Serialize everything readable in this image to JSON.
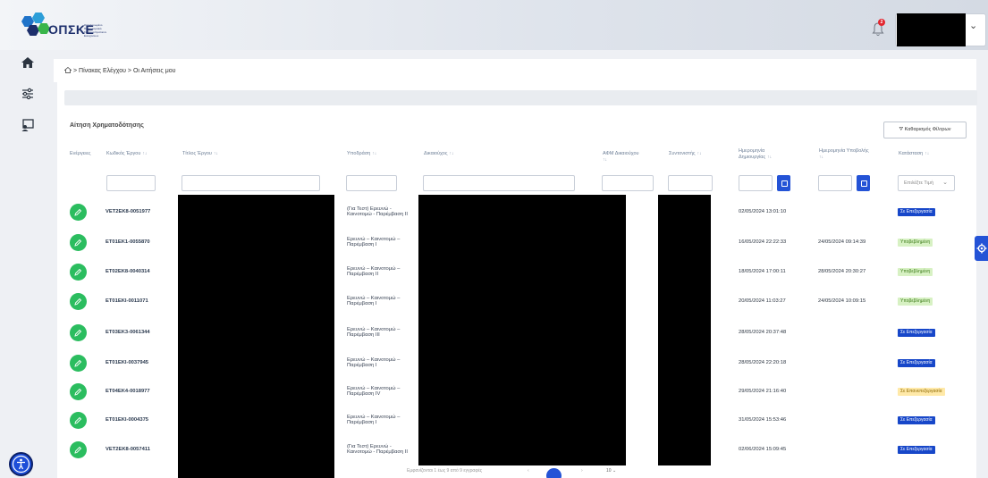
{
  "header": {
    "logo_text": "ΟΠΣΚΕ",
    "logo_subtitle": "Ολοκληρωμένο Πληροφοριακό Σύστημα Κρατικών Ενισχύσεων",
    "notification_count": "2"
  },
  "breadcrumb": "> Πίνακας Ελέγχου > Οι Αιτήσεις μου",
  "card": {
    "title": "Αίτηση Χρηματοδότησης",
    "clear_filters": "Καθαρισμός Φίλτρων"
  },
  "columns": {
    "actions": "Ενέργειες",
    "code": "Κωδικός Έργου",
    "title": "Τίτλος Έργου",
    "action_type": "Υποδράση",
    "beneficiary": "Δικαιούχος",
    "afm": "ΑΦΜ Δικαιούχου",
    "coordinator": "Συντονιστής",
    "created_1": "Ημερομηνία",
    "created_2": "Δημιουργίας",
    "submitted": "Ημερομηνία Υποβολής",
    "status": "Κατάσταση",
    "sort_glyph": "↑↓"
  },
  "filters": {
    "status_placeholder": "Επιλέξτε Τιμή"
  },
  "rows": [
    {
      "code": "VET2EK8-0051977",
      "action_1": "(Για Τεστ) Ερευνώ -",
      "action_2": "Καινοτομώ - Παρέμβαση ΙΙ",
      "created": "02/05/2024 13:01:10",
      "submitted": "",
      "status": "Σε Επεξεργασία"
    },
    {
      "code": "ET01EK1-0055870",
      "action_1": "Ερευνώ – Καινοτομώ –",
      "action_2": "Παρέμβαση Ι",
      "created": "16/05/2024 22:22:33",
      "submitted": "24/05/2024 09:14:39",
      "status": "Υποβεβλημένη"
    },
    {
      "code": "ET02EK8-0040314",
      "action_1": "Ερευνώ – Καινοτομώ –",
      "action_2": "Παρέμβαση ΙΙ",
      "created": "18/05/2024 17:00:11",
      "submitted": "28/05/2024 20:30:27",
      "status": "Υποβεβλημένη"
    },
    {
      "code": "ET01EKI-0011071",
      "action_1": "Ερευνώ – Καινοτομώ –",
      "action_2": "Παρέμβαση Ι",
      "created": "20/05/2024 11:03:27",
      "submitted": "24/05/2024 10:09:15",
      "status": "Υποβεβλημένη"
    },
    {
      "code": "ET03EK3-0061344",
      "action_1": "Ερευνώ – Καινοτομώ –",
      "action_2": "Παρέμβαση ΙΙΙ",
      "created": "28/05/2024 20:37:48",
      "submitted": "",
      "status": "Σε Επεξεργασία"
    },
    {
      "code": "ET01EKI-0037945",
      "action_1": "Ερευνώ – Καινοτομώ –",
      "action_2": "Παρέμβαση Ι",
      "created": "28/05/2024 22:20:18",
      "submitted": "",
      "status": "Σε Επεξεργασία"
    },
    {
      "code": "ET04EK4-0018977",
      "action_1": "Ερευνώ – Καινοτομώ –",
      "action_2": "Παρέμβαση IV",
      "created": "29/05/2024 21:16:40",
      "submitted": "",
      "status": "Σε Επανεπεξεργασία"
    },
    {
      "code": "ET01EKI-0004375",
      "action_1": "Ερευνώ – Καινοτομώ –",
      "action_2": "Παρέμβαση Ι",
      "created": "31/05/2024 15:53:46",
      "submitted": "",
      "status": "Σε Επεξεργασία"
    },
    {
      "code": "VET2EK8-0057411",
      "action_1": "(Για Τεστ) Ερευνώ -",
      "action_2": "Καινοτομώ - Παρέμβαση ΙΙ",
      "created": "02/06/2024 15:09:45",
      "submitted": "",
      "status": "Σε Επεξεργασία"
    }
  ],
  "pager": {
    "summary": "Εμφανίζονται 1 έως 9 από 9 εγγραφές",
    "current_page": "1",
    "page_size": "10"
  },
  "colors": {
    "accent": "#2453d6",
    "edit_button": "#2bbd5f",
    "badge_processing": "#1747c9",
    "badge_submitted": "#d7f1c3",
    "badge_reprocessing": "#ffe9a8"
  }
}
